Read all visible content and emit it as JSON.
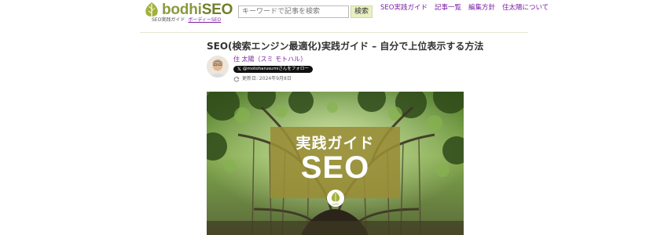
{
  "header": {
    "logo": {
      "word_part1": "bodhi",
      "word_part2": "SEO",
      "subtitle_a": "SEO実践ガイド",
      "subtitle_b": "ボーディーSEO"
    },
    "search": {
      "placeholder": "キーワードで記事を検索",
      "button_label": "検索"
    },
    "nav": [
      {
        "label": "SEO実践ガイド"
      },
      {
        "label": "記事一覧"
      },
      {
        "label": "編集方針"
      },
      {
        "label": "住太陽について"
      }
    ]
  },
  "article": {
    "title": "SEO(検索エンジン最適化)実践ガイド – 自分で上位表示する方法",
    "author_name": "住 太陽（スミ モトハル）",
    "follow_label": "@motoharusumiさんをフォロー",
    "follow_x": "𝕏",
    "updated_label": "更新日: 2024年9月8日",
    "hero": {
      "line1": "実践ガイド",
      "line2": "SEO",
      "badge": "bodhi"
    }
  },
  "colors": {
    "brand_olive": "#8a9a3c",
    "link_purple": "#7b1fa2",
    "hero_overlay": "#998c36"
  }
}
